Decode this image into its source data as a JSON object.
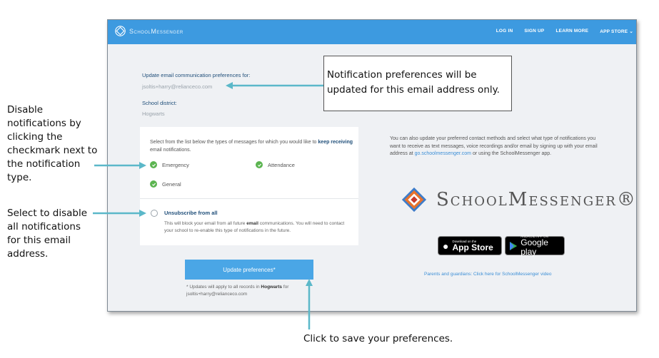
{
  "annotations": {
    "left_top": "Disable notifications by clicking the checkmark next to the notification type.",
    "left_bottom": "Select to disable all notifications for this email address.",
    "callout": "Notification preferences will be updated for this email address only.",
    "bottom": "Click to save your preferences."
  },
  "app": {
    "brand": "SchoolMessenger",
    "nav": [
      "LOG IN",
      "SIGN UP",
      "LEARN MORE",
      "APP STORE"
    ]
  },
  "form": {
    "email_label": "Update email communication preferences for:",
    "email_value": "jsoltis+harry@relianceco.com",
    "district_label": "School district:",
    "district_value": "Hogwarts",
    "intro_pre": "Select from the list below the types of messages for which you would like to",
    "intro_bold": "keep receiving",
    "intro_post": "email notifications.",
    "options": [
      {
        "label": "Emergency",
        "checked": true
      },
      {
        "label": "Attendance",
        "checked": true
      },
      {
        "label": "General",
        "checked": true
      }
    ],
    "unsubscribe_title": "Unsubscribe from all",
    "unsubscribe_desc_pre": "This will block your email from all future",
    "unsubscribe_desc_bold": "email",
    "unsubscribe_desc_post": "communications. You will need to contact your school to re-enable this type of notifications in the future.",
    "button_label": "Update preferences*",
    "note_pre": "* Updates will apply to all records in",
    "note_bold": "Hogwarts",
    "note_post": "for jsoltis+harry@relianceco.com"
  },
  "side": {
    "text_pre": "You can also update your preferred contact methods and select what type of notifications you want to receive as text messages, voice recordings and/or email by signing up with your email address at",
    "text_link": "go.schoolmessenger.com",
    "text_post": "or using the SchoolMessenger app.",
    "logo_text": "SchoolMessenger®",
    "app_store_small": "Download on the",
    "app_store_big": "App Store",
    "google_play_small": "ANDROID APP ON",
    "google_play_big": "Google play",
    "video_link": "Parents and guardians: Click here for SchoolMessenger video"
  },
  "colors": {
    "topbar": "#3d9ae0",
    "button": "#4aa6e6",
    "check": "#5bb450",
    "arrow": "#5bb8c9"
  }
}
